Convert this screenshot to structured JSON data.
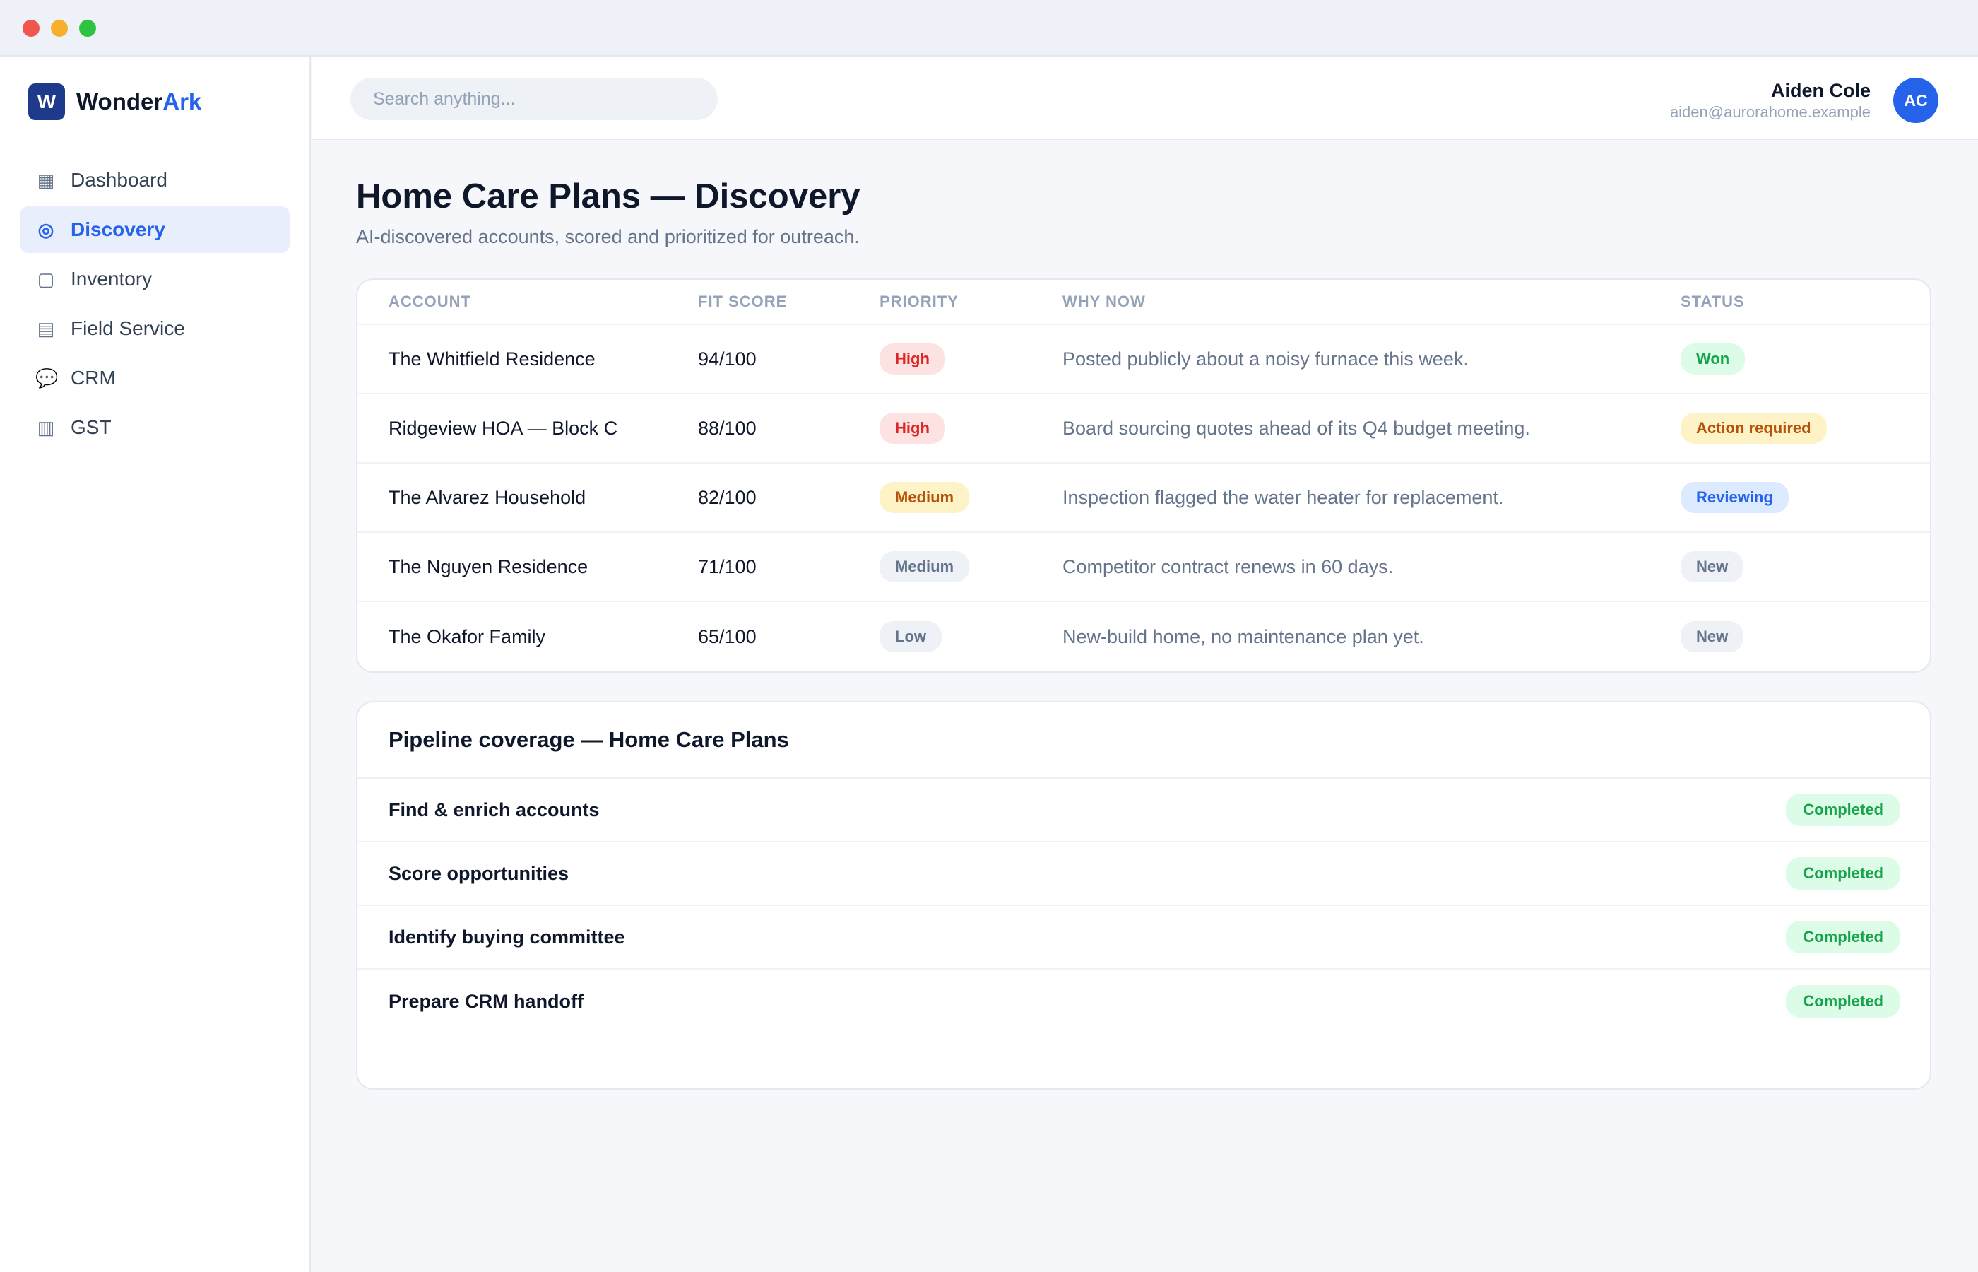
{
  "brand": {
    "name_part1": "Wonder",
    "name_part2": "Ark",
    "logo_letter": "W"
  },
  "nav": [
    {
      "label": "Dashboard",
      "icon": "dashboard-icon",
      "glyph": "▦",
      "active": false
    },
    {
      "label": "Discovery",
      "icon": "target-icon",
      "glyph": "◎",
      "active": true
    },
    {
      "label": "Inventory",
      "icon": "box-icon",
      "glyph": "▢",
      "active": false
    },
    {
      "label": "Field Service",
      "icon": "clipboard-icon",
      "glyph": "▤",
      "active": false
    },
    {
      "label": "CRM",
      "icon": "chat-bubble-icon",
      "glyph": "💬",
      "active": false
    },
    {
      "label": "GST",
      "icon": "ledger-icon",
      "glyph": "▥",
      "active": false
    }
  ],
  "search": {
    "placeholder": "Search anything..."
  },
  "user": {
    "name": "Aiden Cole",
    "email": "aiden@aurorahome.example",
    "initials": "AC"
  },
  "page": {
    "title": "Home Care Plans — Discovery",
    "subtitle": "AI-discovered accounts, scored and prioritized for outreach."
  },
  "table": {
    "headers": {
      "account": "ACCOUNT",
      "fit": "FIT SCORE",
      "priority": "PRIORITY",
      "why": "WHY NOW",
      "status": "STATUS"
    },
    "rows": [
      {
        "account": "The Whitfield Residence",
        "fit": "94/100",
        "priority": "High",
        "why": "Posted publicly about a noisy furnace this week.",
        "status": "Won"
      },
      {
        "account": "Ridgeview HOA — Block C",
        "fit": "88/100",
        "priority": "High",
        "why": "Board sourcing quotes ahead of its Q4 budget meeting.",
        "status": "Action required"
      },
      {
        "account": "The Alvarez Household",
        "fit": "82/100",
        "priority": "Medium",
        "why": "Inspection flagged the water heater for replacement.",
        "status": "Reviewing"
      },
      {
        "account": "The Nguyen Residence",
        "fit": "71/100",
        "priority": "Medium",
        "why": "Competitor contract renews in 60 days.",
        "status": "New"
      },
      {
        "account": "The Okafor Family",
        "fit": "65/100",
        "priority": "Low",
        "why": "New-build home, no maintenance plan yet.",
        "status": "New"
      }
    ]
  },
  "pipeline": {
    "title": "Pipeline coverage — Home Care Plans",
    "steps": [
      {
        "label": "Find & enrich accounts",
        "status": "Completed"
      },
      {
        "label": "Score opportunities",
        "status": "Completed"
      },
      {
        "label": "Identify buying committee",
        "status": "Completed"
      },
      {
        "label": "Prepare CRM handoff",
        "status": "Completed"
      }
    ]
  },
  "colors": {
    "accent": "#2563eb",
    "brand_logo": "#1e3a8a",
    "high": "#dc2626",
    "completed": "#16a34a"
  }
}
